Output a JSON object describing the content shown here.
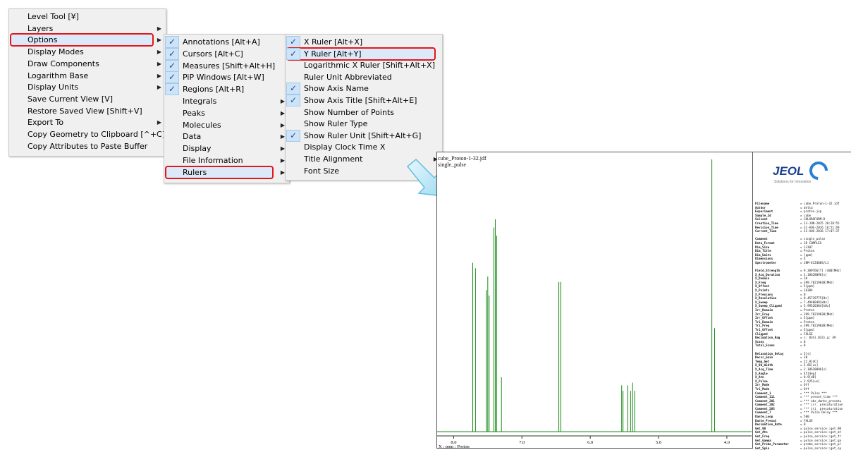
{
  "menu_main": {
    "items": [
      {
        "label": "Level Tool [¥]",
        "sub": false
      },
      {
        "label": "Layers",
        "sub": true
      },
      {
        "label": "Options",
        "sub": true
      },
      {
        "label": "Display Modes",
        "sub": true
      },
      {
        "label": "Draw Components",
        "sub": true
      },
      {
        "label": "Logarithm Base",
        "sub": true
      },
      {
        "label": "Display Units",
        "sub": true
      },
      {
        "label": "Save Current View [V]",
        "sub": false
      },
      {
        "label": "Restore Saved View [Shift+V]",
        "sub": false
      },
      {
        "label": "Export To",
        "sub": true
      },
      {
        "label": "Copy Geometry to Clipboard [^+C]",
        "sub": false
      },
      {
        "label": "Copy Attributes to Paste Buffer",
        "sub": false
      }
    ]
  },
  "menu_options": {
    "items": [
      {
        "label": "Annotations [Alt+A]",
        "checked": true,
        "sub": false
      },
      {
        "label": "Cursors [Alt+C]",
        "checked": true,
        "sub": false
      },
      {
        "label": "Measures [Shift+Alt+H]",
        "checked": true,
        "sub": false
      },
      {
        "label": "PiP Windows [Alt+W]",
        "checked": true,
        "sub": false
      },
      {
        "label": "Regions [Alt+R]",
        "checked": true,
        "sub": false
      },
      {
        "label": "Integrals",
        "checked": false,
        "sub": true
      },
      {
        "label": "Peaks",
        "checked": false,
        "sub": true
      },
      {
        "label": "Molecules",
        "checked": false,
        "sub": true
      },
      {
        "label": "Data",
        "checked": false,
        "sub": true
      },
      {
        "label": "Display",
        "checked": false,
        "sub": true
      },
      {
        "label": "File Information",
        "checked": false,
        "sub": true
      },
      {
        "label": "Rulers",
        "checked": false,
        "sub": true
      }
    ]
  },
  "menu_rulers": {
    "items": [
      {
        "label": "X Ruler [Alt+X]",
        "checked": true,
        "sub": false
      },
      {
        "label": "Y Ruler [Alt+Y]",
        "checked": true,
        "sub": false
      },
      {
        "label": "Logarithmic X Ruler [Shift+Alt+X]",
        "checked": false,
        "sub": false
      },
      {
        "label": "Ruler Unit Abbreviated",
        "checked": false,
        "sub": false
      },
      {
        "label": "Show Axis Name",
        "checked": true,
        "sub": false
      },
      {
        "label": "Show Axis Title [Shift+Alt+E]",
        "checked": true,
        "sub": false
      },
      {
        "label": "Show Number of Points",
        "checked": false,
        "sub": false
      },
      {
        "label": "Show Ruler Type",
        "checked": false,
        "sub": false
      },
      {
        "label": "Show Ruler Unit [Shift+Alt+G]",
        "checked": true,
        "sub": false
      },
      {
        "label": "Display Clock Time X",
        "checked": false,
        "sub": false
      },
      {
        "label": "Title Alignment",
        "checked": false,
        "sub": true
      },
      {
        "label": "Font Size",
        "checked": false,
        "sub": false
      }
    ]
  },
  "spectrum": {
    "filename_text": "cube_Proton-1-32.jdf",
    "comment_text": "single_pulse",
    "axis_title": "X : ppm : Proton",
    "logo_text": "JEOL",
    "logo_subtext": "Solutions for Innovation",
    "trace_color": "#1a8a1a",
    "params": [
      [
        "Filename",
        "= cube_Proton-1-32.jdf"
      ],
      [
        "Author",
        "= delta"
      ],
      [
        "Experiment",
        "= proton.jxp"
      ],
      [
        "Sample_Id",
        "= cube"
      ],
      [
        "Solvent",
        "= CHLOROFORM-D"
      ],
      [
        "Creation_Time",
        "= 13-JUN-2015 20:28:55"
      ],
      [
        "Revision_Time",
        "= 31-AUG-2016 16:51:49"
      ],
      [
        "Current_Time",
        "= 31-AUG-2016 17:07:37"
      ],
      [
        "",
        ""
      ],
      [
        "Comment",
        "= single_pulse"
      ],
      [
        "Data_Format",
        "= 1D COMPLEX"
      ],
      [
        "Dim_Size",
        "= 13107"
      ],
      [
        "Dim_Title",
        "= Proton"
      ],
      [
        "Dim_Units",
        "= [ppm]"
      ],
      [
        "Dimensions",
        "= X"
      ],
      [
        "Spectrometer",
        "= JNM-ECZ400S/L1"
      ],
      [
        "",
        ""
      ],
      [
        "Field_Strength",
        "= 9.389766[T] (400[MHz]"
      ],
      [
        "X_Acq_Duration",
        "= 2.18628096[s]"
      ],
      [
        "X_Domain",
        "= 1H"
      ],
      [
        "X_Freq",
        "= 399.78219838[MHz]"
      ],
      [
        "X_Offset",
        "= 5[ppm]"
      ],
      [
        "X_Points",
        "= 16384"
      ],
      [
        "X_Prescans",
        "= 0"
      ],
      [
        "X_Resolution",
        "= 0.45739775[Hz]"
      ],
      [
        "X_Sweep",
        "= 7.4940048[kHz]"
      ],
      [
        "X_Sweep_Clipped",
        "= 5.99520384[kHz]"
      ],
      [
        "Irr_Domain",
        "= Proton"
      ],
      [
        "Irr_Freq",
        "= 399.78219838[MHz]"
      ],
      [
        "Irr_Offset",
        "= 5[ppm]"
      ],
      [
        "Tri_Domain",
        "= Proton"
      ],
      [
        "Tri_Freq",
        "= 399.78219838[MHz]"
      ],
      [
        "Tri_Offset",
        "= 5[ppm]"
      ],
      [
        "Clipped",
        "= FALSE"
      ],
      [
        "Decimation_Rag",
        "= c: 834(.833),g: 49"
      ],
      [
        "Scans",
        "= 8"
      ],
      [
        "Total_Scans",
        "= 8"
      ],
      [
        "",
        ""
      ],
      [
        "Relaxation_Delay",
        "= 5[s]"
      ],
      [
        "Recvr_Gain",
        "= 30"
      ],
      [
        "Temp_Get",
        "= 22.9[dC]"
      ],
      [
        "X_90_Width",
        "= 5.85[us]"
      ],
      [
        "X_Acq_Time",
        "= 2.18628096[s]"
      ],
      [
        "X_Angle",
        "= 45[deg]"
      ],
      [
        "X_Atn",
        "= 0.9[dB]"
      ],
      [
        "X_Pulse",
        "= 2.925[us]"
      ],
      [
        "Irr_Mode",
        "= Off"
      ],
      [
        "Tri_Mode",
        "= Off"
      ],
      [
        "Comment_1",
        "= *** Pulse ***"
      ],
      [
        "Comment_111",
        "= *** preset_time ***"
      ],
      [
        "Comment_201",
        "= *** obs_dante_presatu"
      ],
      [
        "Comment_202",
        "= *** irr_ presaturation"
      ],
      [
        "Comment_203",
        "= *** tri_ presaturation"
      ],
      [
        "Comment_7",
        "= *** Pulse Delay ***"
      ],
      [
        "Dante_Loop",
        "= 500"
      ],
      [
        "Dante_Presat",
        "= FALSE"
      ],
      [
        "Decimation_Rate",
        "= 0"
      ],
      [
        "Get_90",
        "= pulse_service::get_90"
      ],
      [
        "Get_Atn",
        "= pulse_service::get_at"
      ],
      [
        "Get_Freq",
        "= pulse_service::get_fr"
      ],
      [
        "Get_Gamma",
        "= pulse_service::get_ga"
      ],
      [
        "Get_Probe_Parameter",
        "= probe_service::get_pr"
      ],
      [
        "Get_Spin",
        "= pulse_service::get_sp"
      ]
    ]
  },
  "chart_data": {
    "type": "line",
    "title": "",
    "xlabel": "X : ppm : Proton",
    "ylabel": "",
    "x_reversed": true,
    "xlim": [
      8.2,
      3.7
    ],
    "x_ticks": [
      8.0,
      7.0,
      6.0,
      5.0,
      4.0
    ],
    "grid": false,
    "series": [
      {
        "peaks": [
          {
            "x": 7.72,
            "y": 0.62
          },
          {
            "x": 7.68,
            "y": 0.6
          },
          {
            "x": 7.52,
            "y": 0.52
          },
          {
            "x": 7.5,
            "y": 0.57
          },
          {
            "x": 7.48,
            "y": 0.5
          },
          {
            "x": 7.41,
            "y": 0.75
          },
          {
            "x": 7.39,
            "y": 0.78
          },
          {
            "x": 7.37,
            "y": 0.72
          },
          {
            "x": 7.3,
            "y": 0.2
          },
          {
            "x": 6.46,
            "y": 0.55
          },
          {
            "x": 6.43,
            "y": 0.55
          },
          {
            "x": 5.54,
            "y": 0.17
          },
          {
            "x": 5.52,
            "y": 0.15
          },
          {
            "x": 5.45,
            "y": 0.17
          },
          {
            "x": 5.41,
            "y": 0.15
          },
          {
            "x": 5.38,
            "y": 0.18
          },
          {
            "x": 5.35,
            "y": 0.15
          },
          {
            "x": 4.22,
            "y": 1.0
          },
          {
            "x": 4.18,
            "y": 0.38
          }
        ]
      }
    ]
  }
}
